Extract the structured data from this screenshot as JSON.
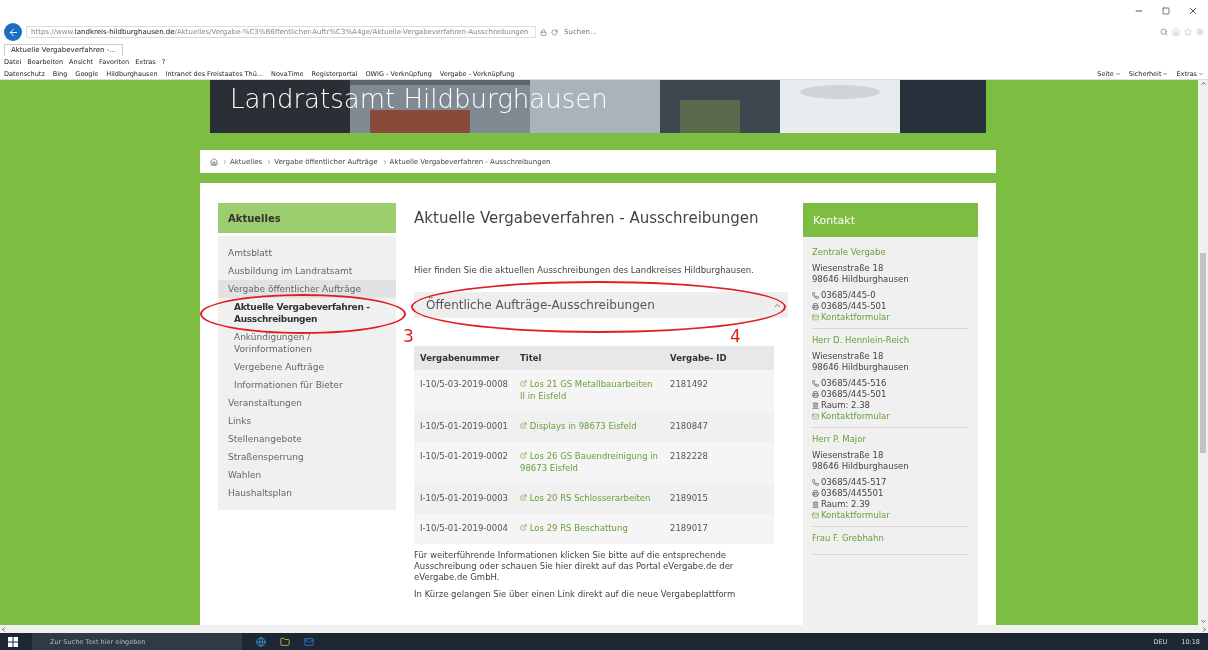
{
  "browser": {
    "url": "https://www.**landkreis-hildburghausen.de**/Aktuelles/Vergabe-%C3%B6ffentlicher-Auftr%C3%A4ge/Aktuelle-Vergabeverfahren-Ausschreibungen",
    "search_placeholder": "Suchen...",
    "tabs": [
      {
        "title": "Aktuelle Vergabeverfahren -...",
        "selected": true
      }
    ],
    "menu": [
      "Datei",
      "Bearbeiten",
      "Ansicht",
      "Favoriten",
      "Extras",
      "?"
    ],
    "favorites": [
      "Datenschutz",
      "Bing",
      "Google",
      "Hildburghausen",
      "Intranet des Freistaates Thü...",
      "NovaTime",
      "Registerportal",
      "OWIG - Verknüpfung",
      "Vergabe - Verknüpfung"
    ],
    "commands": [
      "Seite",
      "Sicherheit",
      "Extras"
    ]
  },
  "banner": {
    "title": "Landratsamt Hildburghausen"
  },
  "breadcrumb": [
    "Aktuelles",
    "Vergabe öffentlicher Aufträge",
    "Aktuelle Vergabeverfahren - Ausschreibungen"
  ],
  "sidebar": {
    "title": "Aktuelles",
    "items": [
      {
        "label": "Amtsblatt",
        "selected": false,
        "expanded": false
      },
      {
        "label": "Ausbildung im Landratsamt",
        "selected": false,
        "expanded": false
      },
      {
        "label": "Vergabe öffentlicher Aufträge",
        "selected": false,
        "expanded": true,
        "children": [
          {
            "label": "Aktuelle Vergabeverfahren - Ausschreibungen",
            "selected": true
          },
          {
            "label": "Ankündigungen / Vorinformationen",
            "selected": false
          },
          {
            "label": "Vergebene Aufträge",
            "selected": false
          },
          {
            "label": "Informationen für Bieter",
            "selected": false
          }
        ]
      },
      {
        "label": "Veranstaltungen",
        "selected": false,
        "expanded": false
      },
      {
        "label": "Links",
        "selected": false,
        "expanded": false
      },
      {
        "label": "Stellenangebote",
        "selected": false,
        "expanded": false
      },
      {
        "label": "Straßensperrung",
        "selected": false,
        "expanded": false
      },
      {
        "label": "Wahlen",
        "selected": false,
        "expanded": false
      },
      {
        "label": "Haushaltsplan",
        "selected": false,
        "expanded": false
      }
    ]
  },
  "main": {
    "title": "Aktuelle Vergabeverfahren - Ausschreibungen",
    "intro": "Hier finden Sie die aktuellen Ausschreibungen des Landkreises Hildburghausen.",
    "section": {
      "title": "Öffentliche Aufträge-Ausschreibungen",
      "expanded": true
    },
    "table": {
      "columns": [
        "Vergabenummer",
        "Titel",
        "Vergabe- ID"
      ],
      "rows": [
        [
          "I-10/5-03-2019-0008",
          "Los 21 GS Metallbauarbeiten II in Eisfeld",
          "2181492"
        ],
        [
          "I-10/5-01-2019-0001",
          "Displays in 98673 Eisfeld",
          "2180847"
        ],
        [
          "I-10/5-01-2019-0002",
          "Los 26 GS Bauendreinigung in 98673 Eisfeld",
          "2182228"
        ],
        [
          "I-10/5-01-2019-0003",
          "Los 20 RS Schlosserarbeiten",
          "2189015"
        ],
        [
          "I-10/5-01-2019-0004",
          "Los 29 RS Beschattung",
          "2189017"
        ]
      ]
    },
    "paragraphs": [
      "Für weiterführende Informationen klicken Sie bitte auf die entsprechende Ausschreibung oder schauen Sie hier direkt auf das Portal eVergabe.de der eVergabe.de GmbH.",
      "In Kürze gelangen Sie über einen Link direkt auf die neue Vergabeplattform"
    ]
  },
  "contact": {
    "title": "Kontakt",
    "entries": [
      {
        "name": "Zentrale Vergabe",
        "street": "Wiesenstraße 18",
        "city": "98646 Hildburghausen",
        "phone": "03685/445-0",
        "fax": "03685/445-501",
        "link": "Kontaktformular"
      },
      {
        "name": "Herr D. Hennlein-Reich",
        "street": "Wiesenstraße 18",
        "city": "98646 Hildburghausen",
        "phone": "03685/445-516",
        "fax": "03685/445-501",
        "room": "Raum: 2.38",
        "link": "Kontaktformular"
      },
      {
        "name": "Herr P. Major",
        "street": "Wiesenstraße 18",
        "city": "98646 Hildburghausen",
        "phone": "03685/445-517",
        "fax": "03685/445501",
        "room": "Raum: 2.39",
        "link": "Kontaktformular"
      },
      {
        "name": "Frau F. Grebhahn"
      }
    ]
  },
  "annotations": [
    {
      "label": "3"
    },
    {
      "label": "4"
    }
  ],
  "taskbar": {
    "search_placeholder": "Zur Suche Text hier eingeben",
    "language": "DEU",
    "time": "10:18"
  }
}
